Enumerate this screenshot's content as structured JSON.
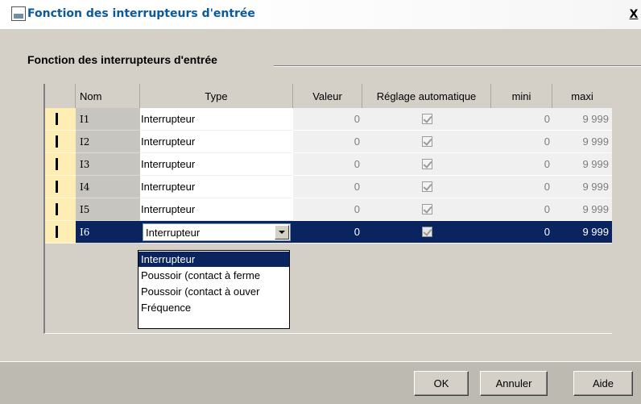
{
  "window": {
    "title": "Fonction des interrupteurs d'entrée",
    "close_label": "X"
  },
  "group": {
    "title": "Fonction des interrupteurs d'entrée"
  },
  "grid": {
    "headers": {
      "nom": "Nom",
      "type": "Type",
      "valeur": "Valeur",
      "auto": "Réglage automatique",
      "mini": "mini",
      "maxi": "maxi"
    },
    "rows": [
      {
        "nom": "I1",
        "type": "Interrupteur",
        "valeur": "0",
        "auto": true,
        "mini": "0",
        "maxi": "9 999"
      },
      {
        "nom": "I2",
        "type": "Interrupteur",
        "valeur": "0",
        "auto": true,
        "mini": "0",
        "maxi": "9 999"
      },
      {
        "nom": "I3",
        "type": "Interrupteur",
        "valeur": "0",
        "auto": true,
        "mini": "0",
        "maxi": "9 999"
      },
      {
        "nom": "I4",
        "type": "Interrupteur",
        "valeur": "0",
        "auto": true,
        "mini": "0",
        "maxi": "9 999"
      },
      {
        "nom": "I5",
        "type": "Interrupteur",
        "valeur": "0",
        "auto": true,
        "mini": "0",
        "maxi": "9 999"
      },
      {
        "nom": "I6",
        "type": "Interrupteur",
        "valeur": "0",
        "auto": true,
        "mini": "0",
        "maxi": "9 999",
        "selected": true
      }
    ],
    "type_options": [
      "Interrupteur",
      "Poussoir (contact à ferme",
      "Poussoir (contact à ouver",
      "Fréquence"
    ]
  },
  "buttons": {
    "ok": "OK",
    "cancel": "Annuler",
    "help": "Aide"
  },
  "colors": {
    "selection": "#0a2460",
    "marker": "#ffeeb4",
    "title_text": "#0a5aa0"
  }
}
